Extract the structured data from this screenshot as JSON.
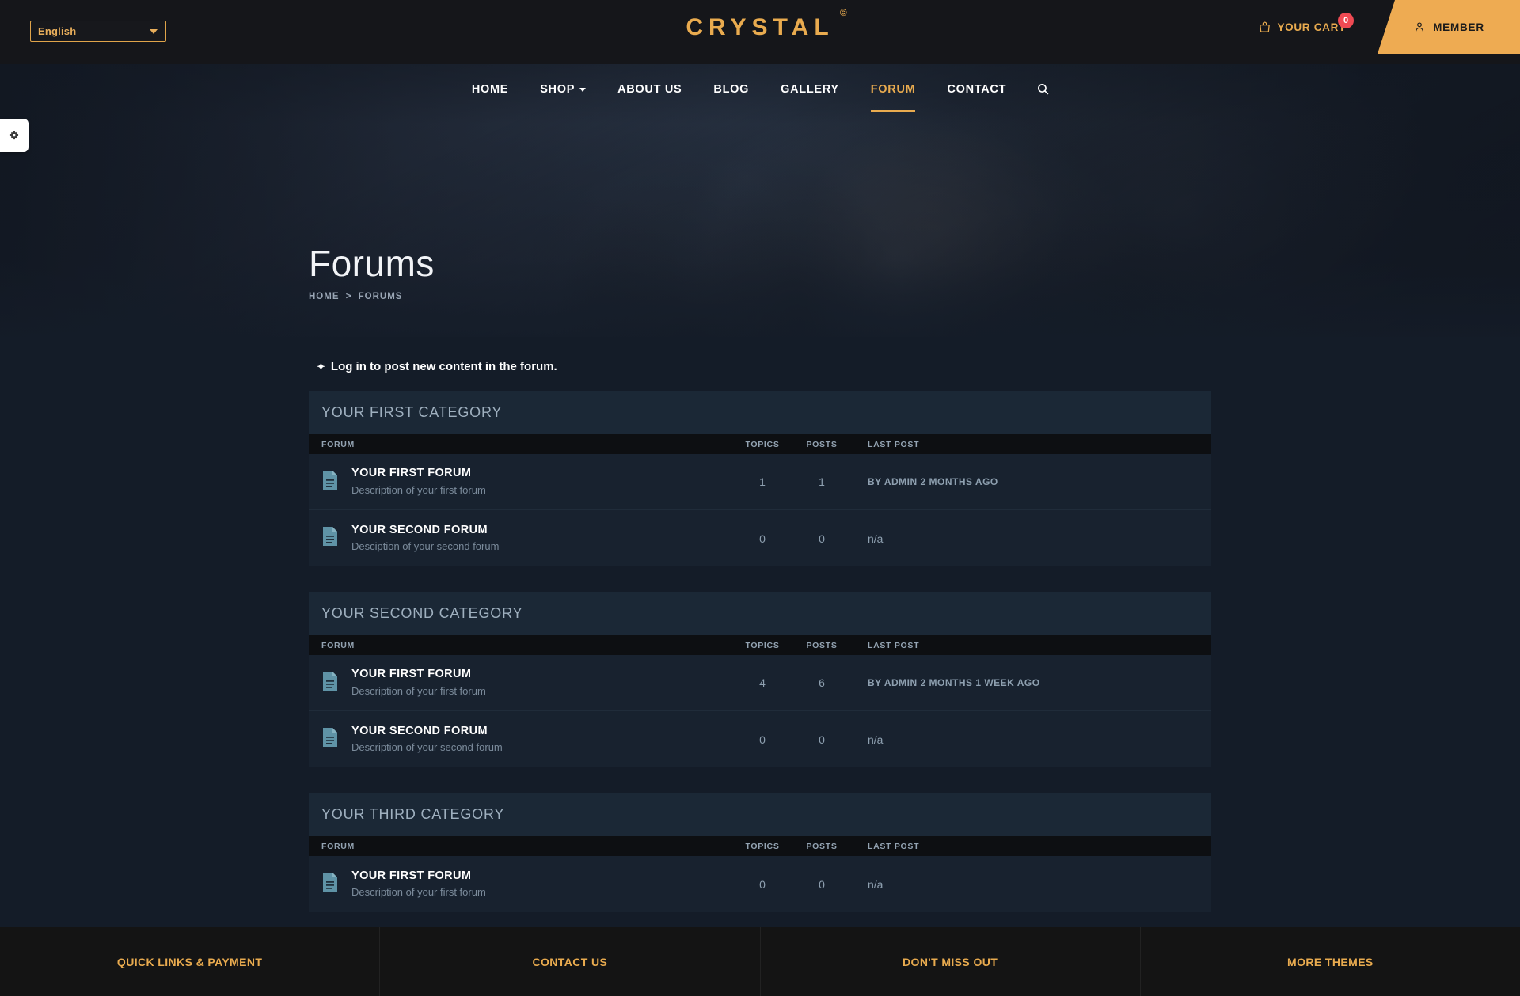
{
  "topbar": {
    "language": {
      "value": "English",
      "icon": "chevron-down-icon"
    },
    "logo": {
      "text": "CRYSTAL",
      "sup": "©"
    },
    "cart": {
      "label": "YOUR CART",
      "count": "0",
      "icon": "cart-bag-icon"
    },
    "member": {
      "label": "MEMBER",
      "icon": "user-icon"
    }
  },
  "nav": {
    "items": [
      {
        "label": "HOME",
        "active": false,
        "chevron": false
      },
      {
        "label": "SHOP",
        "active": false,
        "chevron": true
      },
      {
        "label": "ABOUT US",
        "active": false,
        "chevron": false
      },
      {
        "label": "BLOG",
        "active": false,
        "chevron": false
      },
      {
        "label": "GALLERY",
        "active": false,
        "chevron": false
      },
      {
        "label": "FORUM",
        "active": true,
        "chevron": false
      },
      {
        "label": "CONTACT",
        "active": false,
        "chevron": false
      }
    ],
    "search_icon": "search-icon"
  },
  "hero": {
    "title": "Forums",
    "breadcrumb": {
      "home": "HOME",
      "separator": ">",
      "current": "FORUMS"
    }
  },
  "settings_tab": {
    "icon": "gear-icon"
  },
  "main": {
    "login_notice": {
      "marker": "✦",
      "text": "Log in to post new content in the forum."
    },
    "columns": {
      "forum": "FORUM",
      "topics": "TOPICS",
      "posts": "POSTS",
      "last_post": "LAST POST"
    },
    "categories": [
      {
        "name": "YOUR FIRST CATEGORY",
        "forums": [
          {
            "icon": "document-icon",
            "title": "YOUR FIRST FORUM",
            "description": "Description of your first forum",
            "topics": "1",
            "posts": "1",
            "last_post": "BY ADMIN 2 MONTHS AGO",
            "last_post_na": false
          },
          {
            "icon": "document-icon",
            "title": "YOUR SECOND FORUM",
            "description": "Desciption of your second forum",
            "topics": "0",
            "posts": "0",
            "last_post": "n/a",
            "last_post_na": true
          }
        ]
      },
      {
        "name": "YOUR SECOND CATEGORY",
        "forums": [
          {
            "icon": "document-icon",
            "title": "YOUR FIRST FORUM",
            "description": "Description of your first forum",
            "topics": "4",
            "posts": "6",
            "last_post": "BY ADMIN 2 MONTHS 1 WEEK AGO",
            "last_post_na": false
          },
          {
            "icon": "document-icon",
            "title": "YOUR SECOND FORUM",
            "description": "Description of your second forum",
            "topics": "0",
            "posts": "0",
            "last_post": "n/a",
            "last_post_na": true
          }
        ]
      },
      {
        "name": "YOUR THIRD CATEGORY",
        "forums": [
          {
            "icon": "document-icon",
            "title": "YOUR FIRST FORUM",
            "description": "Description of your first forum",
            "topics": "0",
            "posts": "0",
            "last_post": "n/a",
            "last_post_na": true
          }
        ]
      }
    ]
  },
  "footer": {
    "columns": [
      {
        "label": "QUICK LINKS & PAYMENT"
      },
      {
        "label": "CONTACT US"
      },
      {
        "label": "DON'T MISS OUT"
      },
      {
        "label": "MORE THEMES"
      }
    ]
  },
  "colors": {
    "accent": "#e9ab4f",
    "badge": "#ef4a53",
    "page_bg": "#141c28",
    "panel_bg": "#18222f",
    "category_bg": "#1b2836",
    "table_head_bg": "#0d0f12",
    "icon_teal": "#5f93a6"
  }
}
